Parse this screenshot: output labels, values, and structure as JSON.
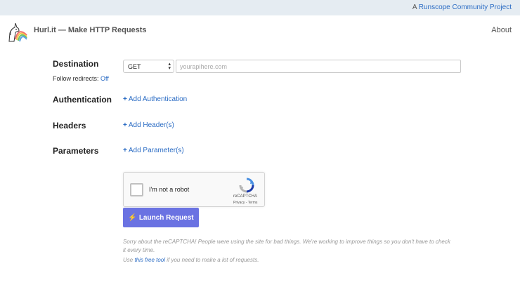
{
  "topbar": {
    "prefix": "A",
    "link_label": "Runscope Community Project"
  },
  "header": {
    "brand": "Hurl.it — Make HTTP Requests",
    "about_label": "About"
  },
  "destination": {
    "label": "Destination",
    "follow_label": "Follow redirects:",
    "follow_value": "Off",
    "method": "GET",
    "url_placeholder": "yourapihere.com",
    "url_value": ""
  },
  "authentication": {
    "label": "Authentication",
    "add_label": "Add Authentication"
  },
  "headers": {
    "label": "Headers",
    "add_label": "Add Header(s)"
  },
  "parameters": {
    "label": "Parameters",
    "add_label": "Add Parameter(s)"
  },
  "captcha": {
    "checkbox_label": "I'm not a robot",
    "brand": "reCAPTCHA",
    "privacy": "Privacy",
    "separator": " - ",
    "terms": "Terms"
  },
  "launch": {
    "label": "Launch Request"
  },
  "note": {
    "line1": "Sorry about the reCAPTCHA! People were using the site for bad things. We're working to improve things so you don't have to check it every time.",
    "line2_prefix": "Use ",
    "line2_link": "this free tool",
    "line2_suffix": " if you need to make a lot of requests."
  },
  "colors": {
    "accent": "#2b6cc4",
    "launch_button": "#6a72e2",
    "topbar_bg": "#e5ecf2"
  },
  "icons": {
    "logo": "unicorn-rainbow-icon",
    "captcha": "recaptcha-icon",
    "plus": "plus-icon",
    "bolt": "bolt-icon",
    "select": "select-arrows-icon"
  }
}
